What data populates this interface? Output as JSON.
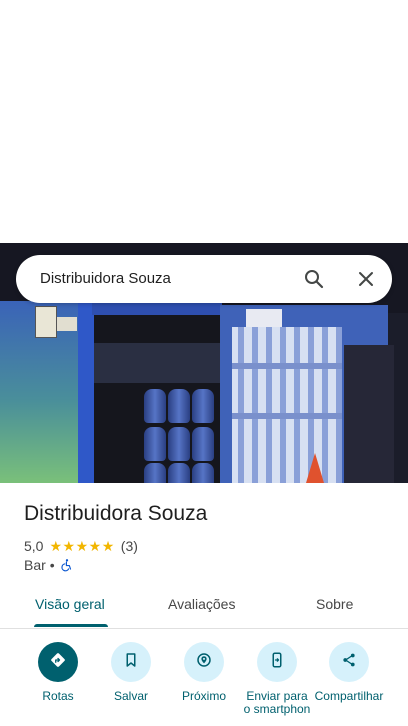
{
  "search": {
    "query": "Distribuidora Souza"
  },
  "place": {
    "name": "Distribuidora Souza",
    "rating": "5,0",
    "stars": 5,
    "review_count": "(3)",
    "category": "Bar",
    "separator": "•"
  },
  "tabs": [
    {
      "label": "Visão geral",
      "active": true
    },
    {
      "label": "Avaliações",
      "active": false
    },
    {
      "label": "Sobre",
      "active": false
    }
  ],
  "actions": [
    {
      "label": "Rotas",
      "icon": "directions-icon"
    },
    {
      "label": "Salvar",
      "icon": "bookmark-icon"
    },
    {
      "label": "Próximo",
      "icon": "nearby-icon"
    },
    {
      "label": "Enviar para o smartphone",
      "icon": "send-to-phone-icon"
    },
    {
      "label": "Compartilhar",
      "icon": "share-icon"
    }
  ],
  "colors": {
    "accent": "#00606e",
    "action_bg": "#d6f1fb",
    "star": "#f2b600"
  }
}
